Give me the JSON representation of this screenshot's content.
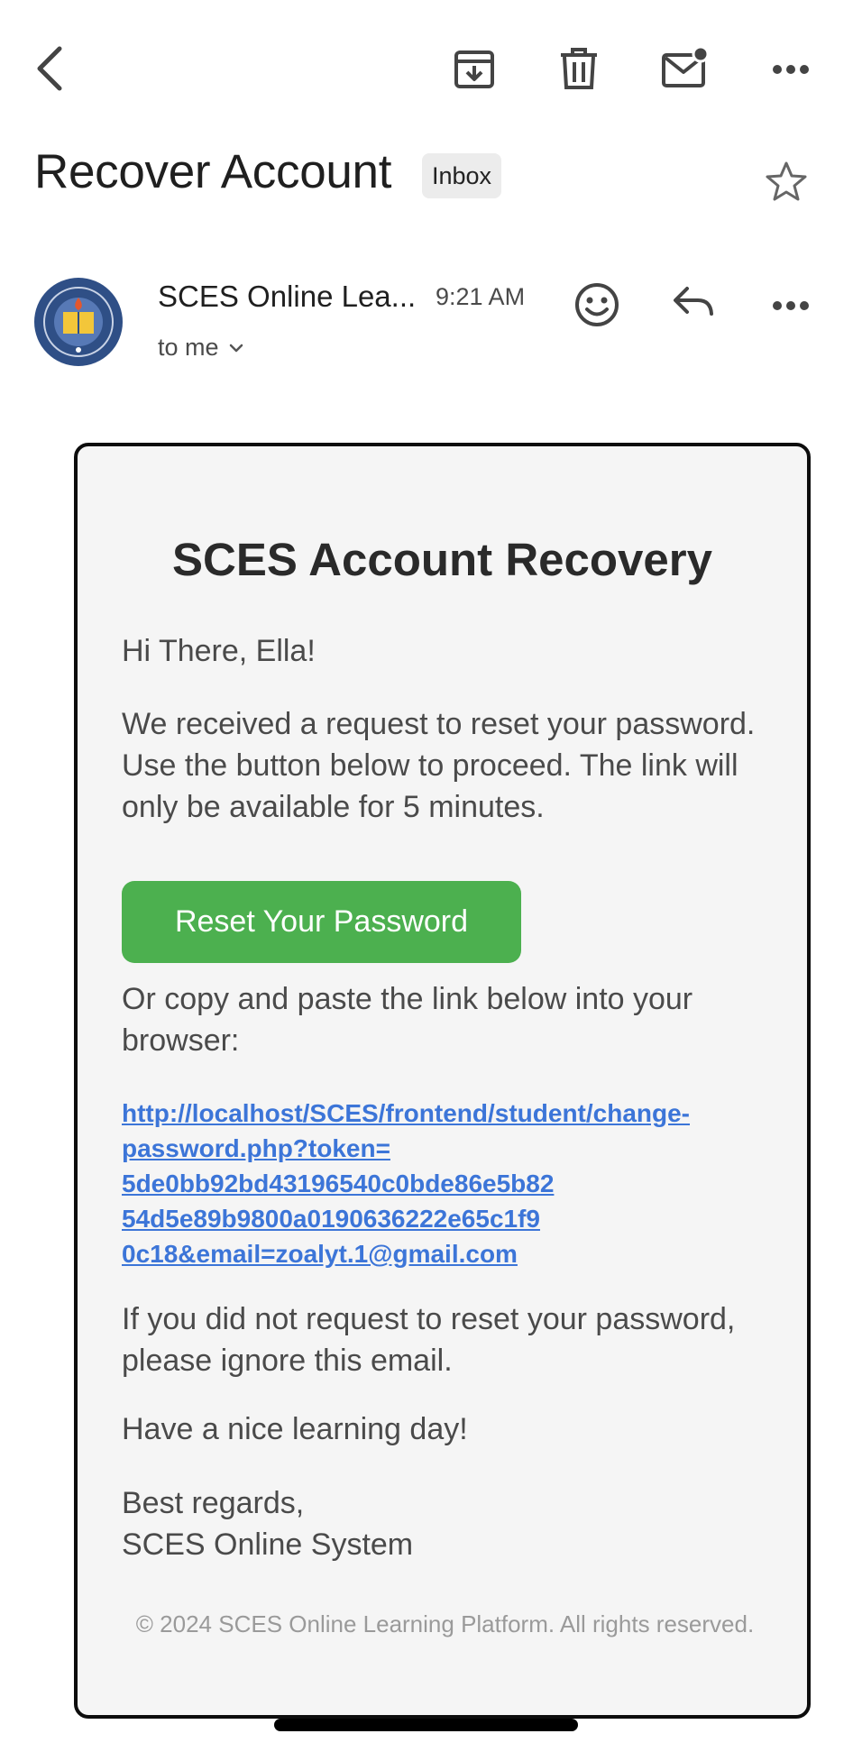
{
  "toolbar": {
    "icons": [
      "back-arrow-icon",
      "archive-icon",
      "trash-icon",
      "mark-unread-icon",
      "more-icon"
    ]
  },
  "email": {
    "subject": "Recover Account",
    "label": "Inbox",
    "sender": "SCES Online Lea...",
    "time": "9:21 AM",
    "recipient": "to me"
  },
  "body": {
    "title": "SCES Account Recovery",
    "greeting": "Hi There, Ella!",
    "paragraph1": "We received a request to reset your password. Use the button below to proceed. The link will only be available for 5 minutes.",
    "button_label": "Reset Your Password",
    "paragraph2": "Or copy and paste the link below into your browser:",
    "link_lines": [
      "http://localhost/SCES/frontend/student/change-",
      "password.php?token=",
      "5de0bb92bd43196540c0bde86e5b82",
      "54d5e89b9800a0190636222e65c1f9",
      "0c18&email=zoalyt.1@gmail.com"
    ],
    "paragraph3": "If you did not request to reset your password, please ignore this email.",
    "paragraph4": "Have a nice learning day!",
    "signoff_line1": "Best regards,",
    "signoff_line2": "SCES Online System",
    "footer": "© 2024 SCES Online Learning Platform. All rights reserved."
  },
  "colors": {
    "button_green": "#4cb04f",
    "link_blue": "#3c75d8",
    "card_bg": "#f5f5f5",
    "avatar_navy": "#2f4f86"
  }
}
